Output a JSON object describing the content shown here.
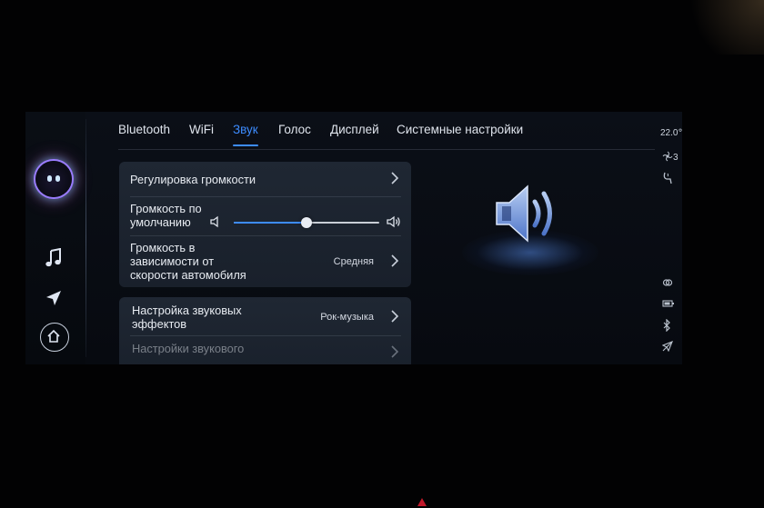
{
  "tabs": [
    {
      "label": "Bluetooth",
      "active": false
    },
    {
      "label": "WiFi",
      "active": false
    },
    {
      "label": "Звук",
      "active": true
    },
    {
      "label": "Голос",
      "active": false
    },
    {
      "label": "Дисплей",
      "active": false
    },
    {
      "label": "Системные настройки",
      "active": false
    }
  ],
  "sound": {
    "volume_control": {
      "label": "Регулировка громкости"
    },
    "default_volume": {
      "label_line1": "Громкость по",
      "label_line2": "умолчанию",
      "level": 0.5
    },
    "speed_volume": {
      "label_line1": "Громкость в",
      "label_line2": "зависимости от",
      "label_line3": "скорости автомобиля",
      "value": "Средняя"
    },
    "effects": {
      "label_line1": "Настройка звуковых",
      "label_line2": "эффектов",
      "value": "Рок-музыка"
    },
    "sound_field": {
      "label": "Настройки звукового"
    }
  },
  "status_bar": {
    "temperature": "22.0℃",
    "fan_level": "3"
  },
  "rail": {
    "icons": [
      "assistant-avatar",
      "music-note-icon",
      "navigation-arrow-icon",
      "home-icon"
    ]
  },
  "colors": {
    "accent": "#3d8cff",
    "card": "#1f2733",
    "background": "#07090e"
  }
}
